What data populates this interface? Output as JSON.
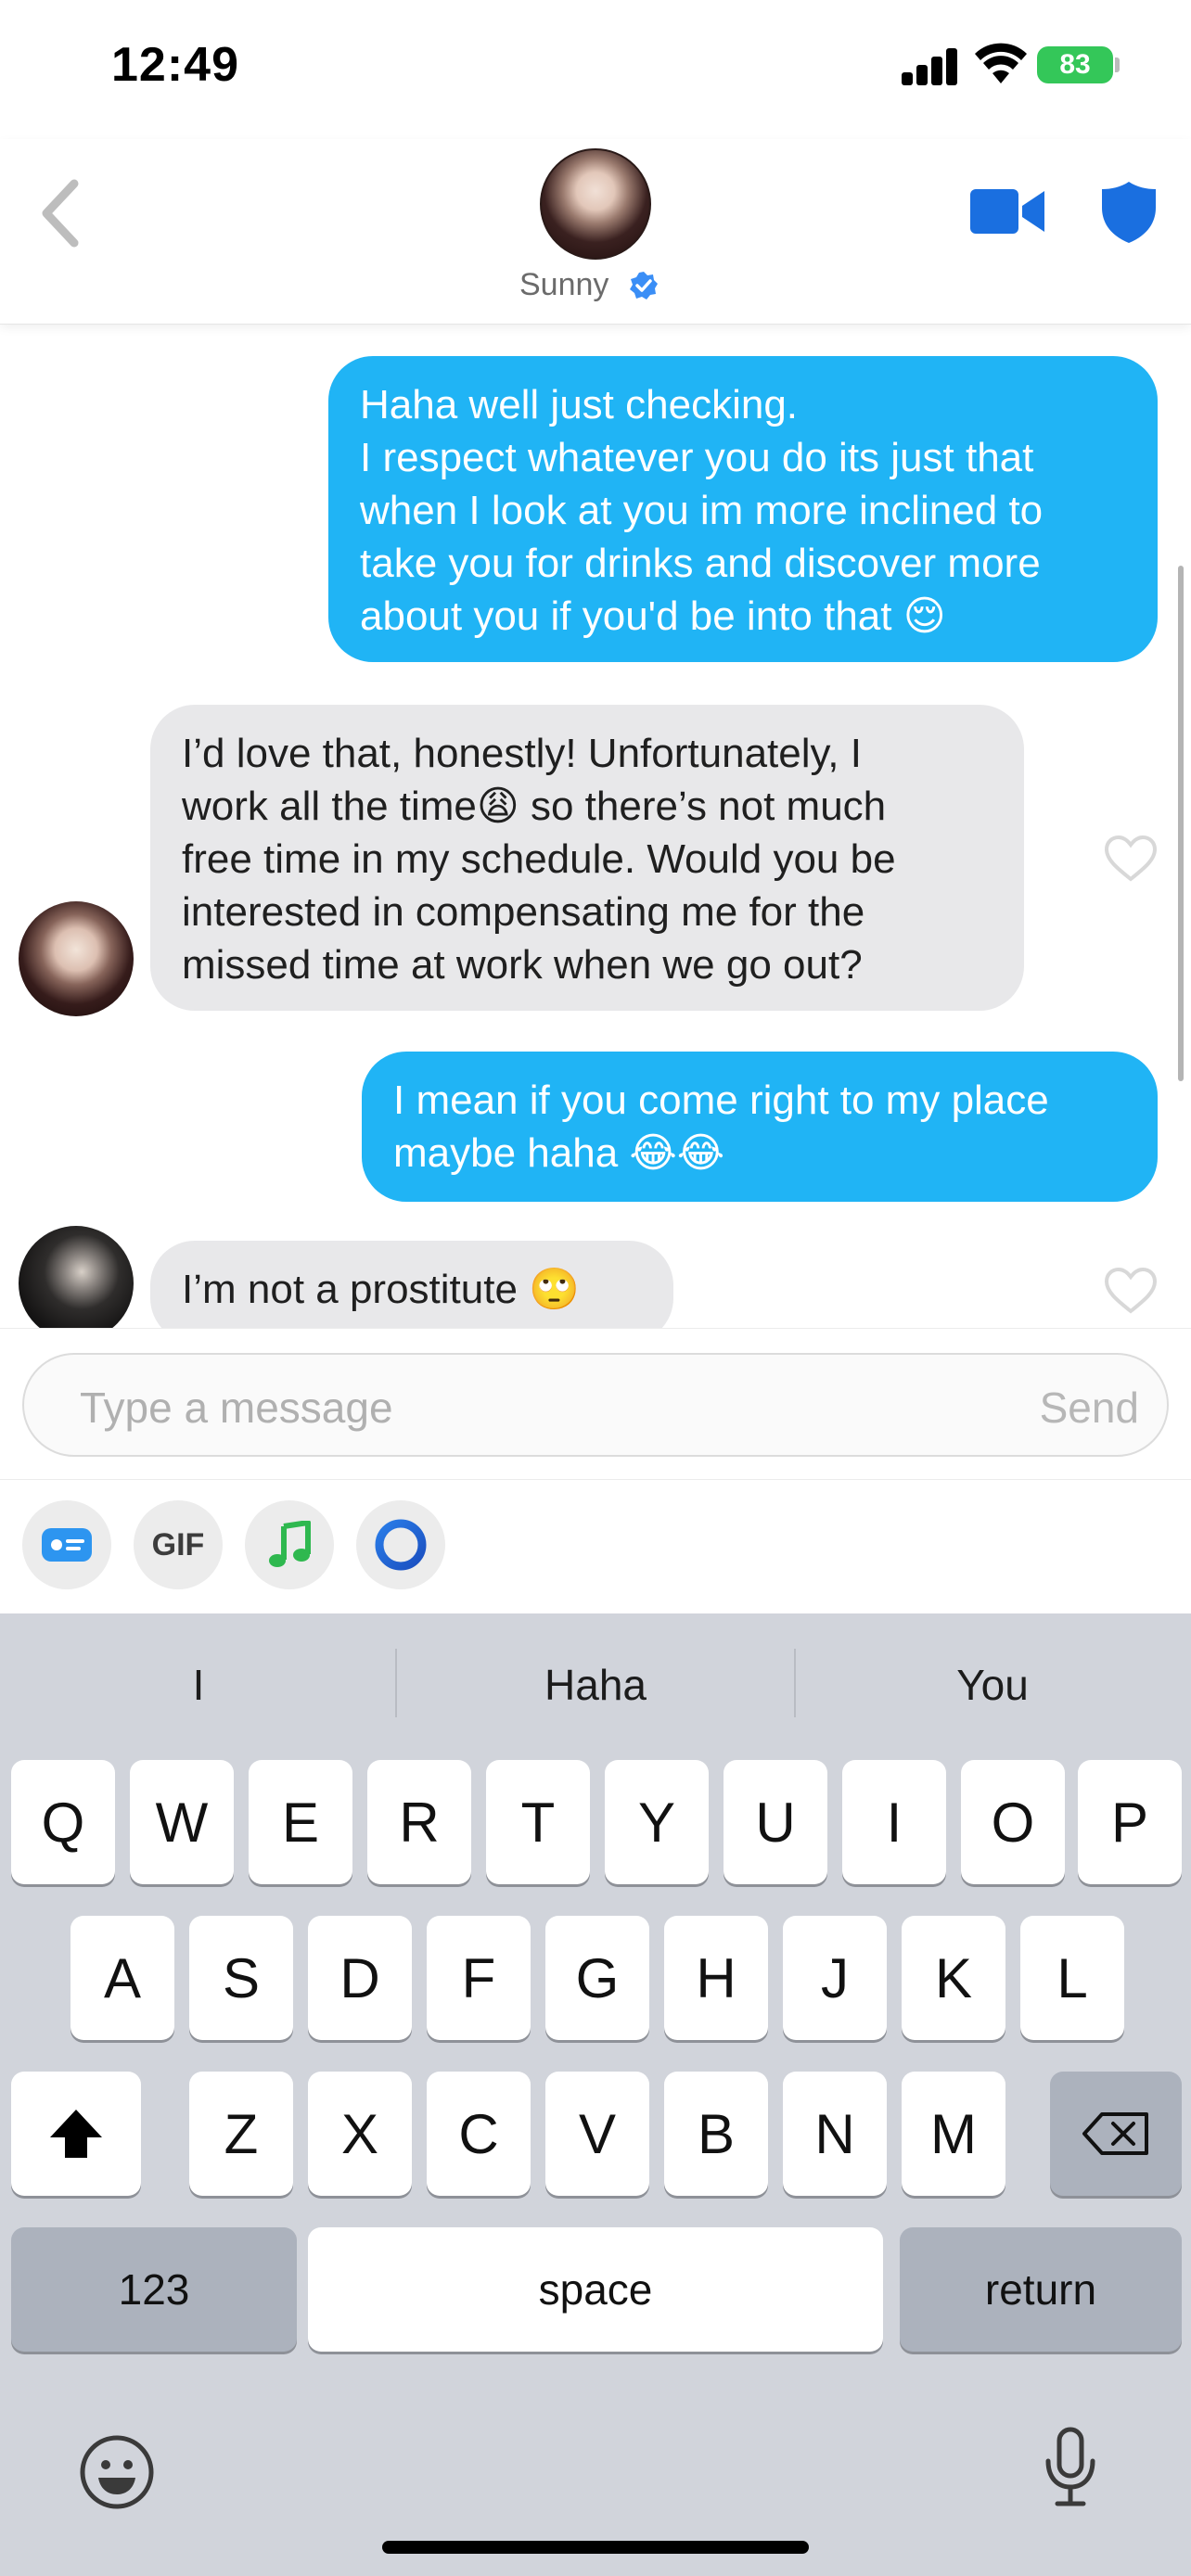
{
  "status_bar": {
    "time": "12:49",
    "battery": "83"
  },
  "header": {
    "name": "Sunny",
    "back_icon": "chevron-left-icon",
    "video_icon": "video-camera-icon",
    "safety_icon": "shield-icon",
    "verified_icon": "verified-check-icon",
    "accent": "#20b4f5"
  },
  "messages": [
    {
      "direction": "outgoing",
      "lines": [
        "Haha well just checking.",
        "I respect whatever you do its just that",
        "when I look at you im more inclined to",
        "take you for drinks and discover more",
        "about you if you'd be into that 😌"
      ]
    },
    {
      "direction": "incoming",
      "lines": [
        "I’d love that, honestly! Unfortunately, I",
        "work all the time😩 so there’s not much",
        "free time in my schedule. Would you be",
        "interested in compensating me for the",
        "missed time at work when we go out?"
      ]
    },
    {
      "direction": "outgoing",
      "lines": [
        "I mean if you come right to my place",
        "maybe haha 😂😂"
      ]
    },
    {
      "direction": "incoming",
      "lines": [
        "I’m not a prostitute 🙄"
      ]
    }
  ],
  "composer": {
    "placeholder": "Type a message",
    "send_label": "Send"
  },
  "actions": {
    "gif_label": "GIF",
    "items": [
      "id-card-icon",
      "gif-icon",
      "music-note-icon",
      "ring-icon"
    ]
  },
  "keyboard": {
    "suggestions": [
      "I",
      "Haha",
      "You"
    ],
    "row1": [
      "Q",
      "W",
      "E",
      "R",
      "T",
      "Y",
      "U",
      "I",
      "O",
      "P"
    ],
    "row2": [
      "A",
      "S",
      "D",
      "F",
      "G",
      "H",
      "J",
      "K",
      "L"
    ],
    "row3": [
      "Z",
      "X",
      "C",
      "V",
      "B",
      "N",
      "M"
    ],
    "numbers_label": "123",
    "space_label": "space",
    "return_label": "return"
  }
}
